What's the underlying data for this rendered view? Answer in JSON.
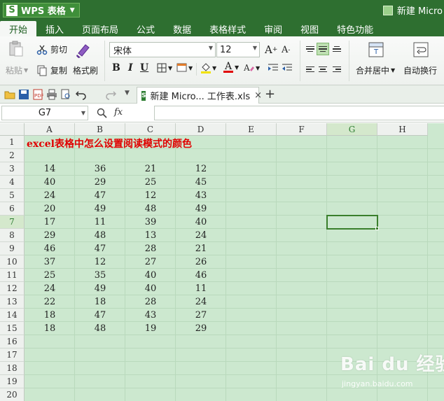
{
  "app": {
    "name": "WPS 表格",
    "logo_letter": "S",
    "document_title": "新建 Micro"
  },
  "menu": {
    "tabs": [
      "开始",
      "插入",
      "页面布局",
      "公式",
      "数据",
      "表格样式",
      "审阅",
      "视图",
      "特色功能"
    ],
    "active_index": 0
  },
  "ribbon": {
    "paste_label": "粘贴",
    "cut_label": "剪切",
    "copy_label": "复制",
    "format_painter_label": "格式刷",
    "font_name": "宋体",
    "font_size": "12",
    "bold": "B",
    "italic": "I",
    "underline": "U",
    "merge_center_label": "合并居中",
    "wrap_text_label": "自动换行"
  },
  "document_tab": {
    "title": "新建 Micro... 工作表.xls",
    "close": "×",
    "new_tab": "+"
  },
  "formula_bar": {
    "name_box": "G7",
    "fx": "fx",
    "formula": ""
  },
  "sheet": {
    "columns": [
      "A",
      "B",
      "C",
      "D",
      "E",
      "F",
      "G",
      "H"
    ],
    "rows": [
      "1",
      "2",
      "3",
      "4",
      "5",
      "6",
      "7",
      "8",
      "9",
      "10",
      "11",
      "12",
      "13",
      "14",
      "15",
      "16",
      "17",
      "18",
      "19",
      "20"
    ],
    "selected_column": "G",
    "selected_row": "7",
    "title": "excel表格中怎么设置阅读模式的颜色",
    "data": [
      [
        "14",
        "36",
        "21",
        "12"
      ],
      [
        "40",
        "29",
        "25",
        "45"
      ],
      [
        "24",
        "47",
        "12",
        "43"
      ],
      [
        "20",
        "49",
        "48",
        "49"
      ],
      [
        "17",
        "11",
        "39",
        "40"
      ],
      [
        "29",
        "48",
        "13",
        "24"
      ],
      [
        "46",
        "47",
        "28",
        "21"
      ],
      [
        "37",
        "12",
        "27",
        "26"
      ],
      [
        "25",
        "35",
        "40",
        "46"
      ],
      [
        "24",
        "49",
        "40",
        "11"
      ],
      [
        "22",
        "18",
        "28",
        "24"
      ],
      [
        "18",
        "47",
        "43",
        "27"
      ],
      [
        "18",
        "48",
        "19",
        "29"
      ]
    ],
    "reading_mode_color": "#cce8cf",
    "accent_color": "#2e6f30"
  },
  "watermark": {
    "main": "Bai du 经验",
    "sub": "jingyan.baidu.com"
  }
}
